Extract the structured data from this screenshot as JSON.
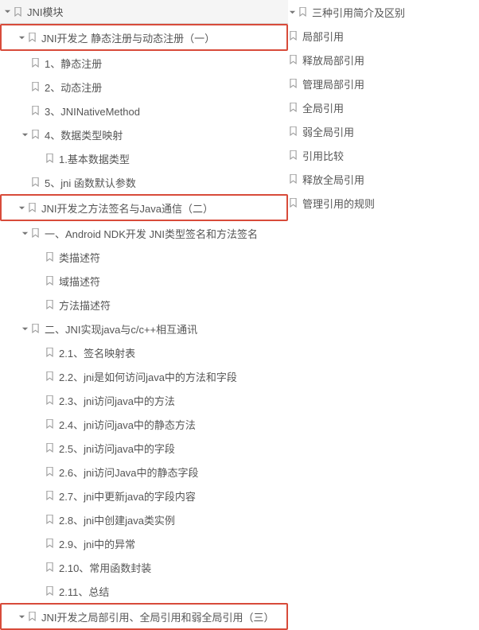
{
  "left": {
    "root": "JNI模块",
    "n1": "JNI开发之 静态注册与动态注册（一）",
    "n1_1": "1、静态注册",
    "n1_2": "2、动态注册",
    "n1_3": "3、JNINativeMethod",
    "n1_4": "4、数据类型映射",
    "n1_4_1": "1.基本数据类型",
    "n1_5": "5、jni 函数默认参数",
    "n2": "JNI开发之方法签名与Java通信（二）",
    "n2_1": "一、Android NDK开发 JNI类型签名和方法签名",
    "n2_1_1": "类描述符",
    "n2_1_2": "域描述符",
    "n2_1_3": "方法描述符",
    "n2_2": "二、JNI实现java与c/c++相互通讯",
    "n2_2_1": "2.1、签名映射表",
    "n2_2_2": "2.2、jni是如何访问java中的方法和字段",
    "n2_2_3": "2.3、jni访问java中的方法",
    "n2_2_4": "2.4、jni访问java中的静态方法",
    "n2_2_5": "2.5、jni访问java中的字段",
    "n2_2_6": "2.6、jni访问Java中的静态字段",
    "n2_2_7": "2.7、jni中更新java的字段内容",
    "n2_2_8": "2.8、jni中创建java类实例",
    "n2_2_9": "2.9、jni中的异常",
    "n2_2_10": "2.10、常用函数封装",
    "n2_2_11": "2.11、总结",
    "n3": "JNI开发之局部引用、全局引用和弱全局引用（三）"
  },
  "right": {
    "root": "三种引用简介及区别",
    "r1": "局部引用",
    "r2": "释放局部引用",
    "r3": "管理局部引用",
    "r4": "全局引用",
    "r5": "弱全局引用",
    "r6": "引用比较",
    "r7": "释放全局引用",
    "r8": "管理引用的规则"
  }
}
